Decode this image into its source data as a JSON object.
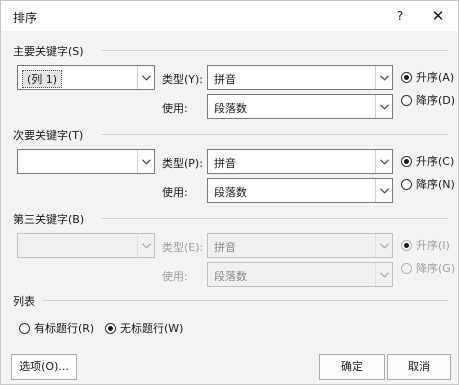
{
  "dialog": {
    "title": "排序",
    "help": "?",
    "close": "✕"
  },
  "primary": {
    "heading": "主要关键字(S)",
    "column_value": "(列 1)",
    "type_label": "类型(Y):",
    "type_value": "拼音",
    "use_label": "使用:",
    "use_value": "段落数",
    "asc_label": "升序(A)",
    "desc_label": "降序(D)"
  },
  "secondary": {
    "heading": "次要关键字(T)",
    "column_value": "",
    "type_label": "类型(P):",
    "type_value": "拼音",
    "use_label": "使用:",
    "use_value": "段落数",
    "asc_label": "升序(C)",
    "desc_label": "降序(N)"
  },
  "third": {
    "heading": "第三关键字(B)",
    "column_value": "",
    "type_label": "类型(E):",
    "type_value": "拼音",
    "use_label": "使用:",
    "use_value": "段落数",
    "asc_label": "升序(I)",
    "desc_label": "降序(G)"
  },
  "list": {
    "heading": "列表",
    "header_row_label": "有标题行(R)",
    "no_header_row_label": "无标题行(W)"
  },
  "buttons": {
    "options": "选项(O)...",
    "ok": "确定",
    "cancel": "取消"
  }
}
